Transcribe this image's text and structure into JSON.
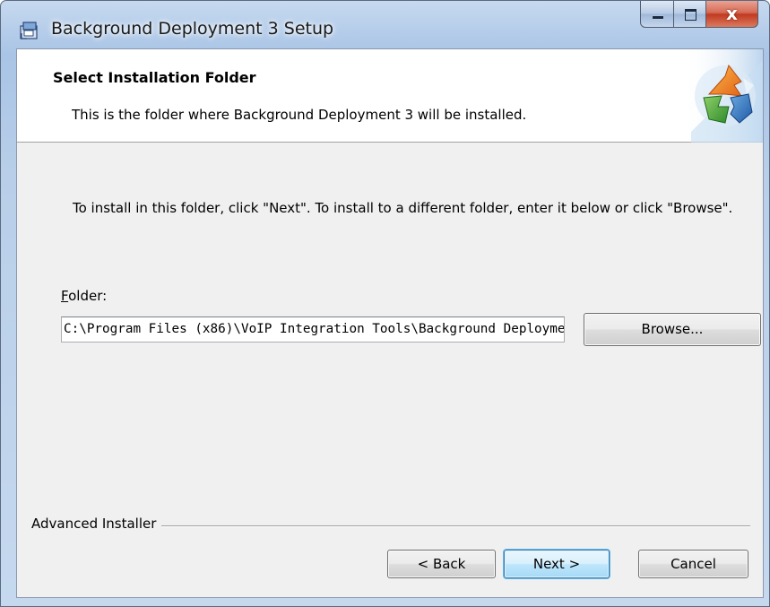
{
  "window": {
    "title": "Background Deployment 3 Setup",
    "app_icon": "installer-icon",
    "close_glyph": "x"
  },
  "header": {
    "title": "Select Installation Folder",
    "subtitle": "This is the folder where Background Deployment 3 will be installed.",
    "logo": "puzzle-arrows-logo"
  },
  "instructions": "To install in this folder, click \"Next\". To install to a different folder, enter it below or click \"Browse\".",
  "folder": {
    "label_mnemonic": "F",
    "label_rest": "older:",
    "value": "C:\\Program Files (x86)\\VoIP Integration Tools\\Background Deployme"
  },
  "buttons": {
    "browse": "Browse...",
    "back": "< Back",
    "next": "Next >",
    "cancel": "Cancel"
  },
  "branding": "Advanced Installer",
  "colors": {
    "accent_next_border": "#3c7fb1",
    "window_frame": "#b9cfe9",
    "close_button": "#c0391f"
  }
}
